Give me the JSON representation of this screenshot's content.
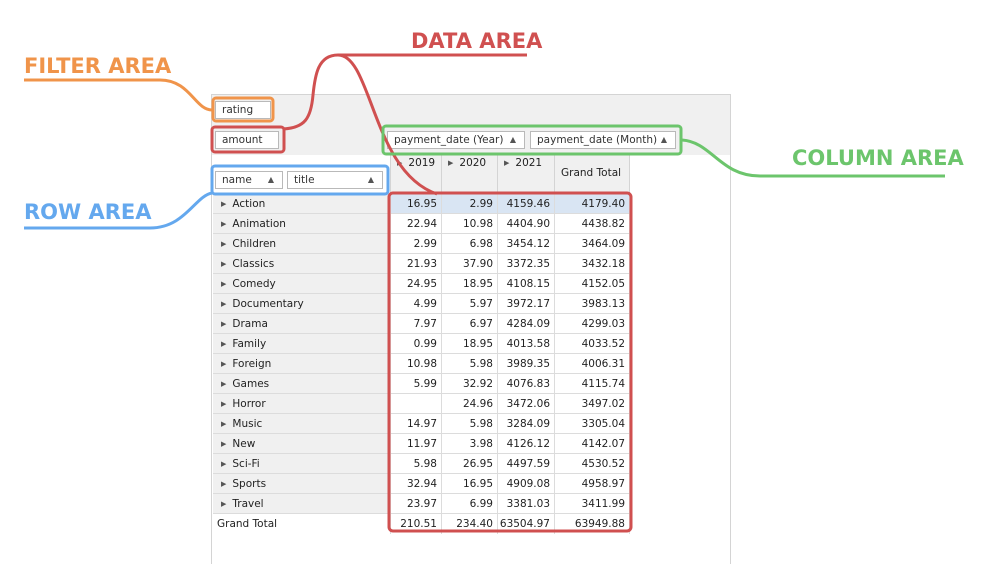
{
  "labels": {
    "filter_area": {
      "text": "FILTER AREA",
      "color": "#f0944a"
    },
    "data_area": {
      "text": "DATA AREA",
      "color": "#d05050"
    },
    "column_area": {
      "text": "COLUMN AREA",
      "color": "#6cc56c"
    },
    "row_area": {
      "text": "ROW AREA",
      "color": "#64a8ee"
    }
  },
  "filter_field": {
    "label": "rating"
  },
  "data_field": {
    "label": "amount"
  },
  "column_fields": [
    {
      "label": "payment_date (Year)",
      "sort_icon": "sort-asc-icon"
    },
    {
      "label": "payment_date (Month)",
      "sort_icon": "sort-asc-icon"
    }
  ],
  "row_fields": [
    {
      "label": "name",
      "sort_icon": "sort-asc-icon"
    },
    {
      "label": "title",
      "sort_icon": "sort-asc-icon"
    }
  ],
  "column_headers": [
    "2019",
    "2020",
    "2021"
  ],
  "grand_total_label": "Grand Total",
  "rows": [
    {
      "name": "Action",
      "values": [
        "16.95",
        "2.99",
        "4159.46",
        "4179.40"
      ]
    },
    {
      "name": "Animation",
      "values": [
        "22.94",
        "10.98",
        "4404.90",
        "4438.82"
      ]
    },
    {
      "name": "Children",
      "values": [
        "2.99",
        "6.98",
        "3454.12",
        "3464.09"
      ]
    },
    {
      "name": "Classics",
      "values": [
        "21.93",
        "37.90",
        "3372.35",
        "3432.18"
      ]
    },
    {
      "name": "Comedy",
      "values": [
        "24.95",
        "18.95",
        "4108.15",
        "4152.05"
      ]
    },
    {
      "name": "Documentary",
      "values": [
        "4.99",
        "5.97",
        "3972.17",
        "3983.13"
      ]
    },
    {
      "name": "Drama",
      "values": [
        "7.97",
        "6.97",
        "4284.09",
        "4299.03"
      ]
    },
    {
      "name": "Family",
      "values": [
        "0.99",
        "18.95",
        "4013.58",
        "4033.52"
      ]
    },
    {
      "name": "Foreign",
      "values": [
        "10.98",
        "5.98",
        "3989.35",
        "4006.31"
      ]
    },
    {
      "name": "Games",
      "values": [
        "5.99",
        "32.92",
        "4076.83",
        "4115.74"
      ]
    },
    {
      "name": "Horror",
      "values": [
        "",
        "24.96",
        "3472.06",
        "3497.02"
      ]
    },
    {
      "name": "Music",
      "values": [
        "14.97",
        "5.98",
        "3284.09",
        "3305.04"
      ]
    },
    {
      "name": "New",
      "values": [
        "11.97",
        "3.98",
        "4126.12",
        "4142.07"
      ]
    },
    {
      "name": "Sci-Fi",
      "values": [
        "5.98",
        "26.95",
        "4497.59",
        "4530.52"
      ]
    },
    {
      "name": "Sports",
      "values": [
        "32.94",
        "16.95",
        "4909.08",
        "4958.97"
      ]
    },
    {
      "name": "Travel",
      "values": [
        "23.97",
        "6.99",
        "3381.03",
        "3411.99"
      ]
    }
  ],
  "grand_total_values": [
    "210.51",
    "234.40",
    "63504.97",
    "63949.88"
  ],
  "selection_color": "#d9e5f3"
}
